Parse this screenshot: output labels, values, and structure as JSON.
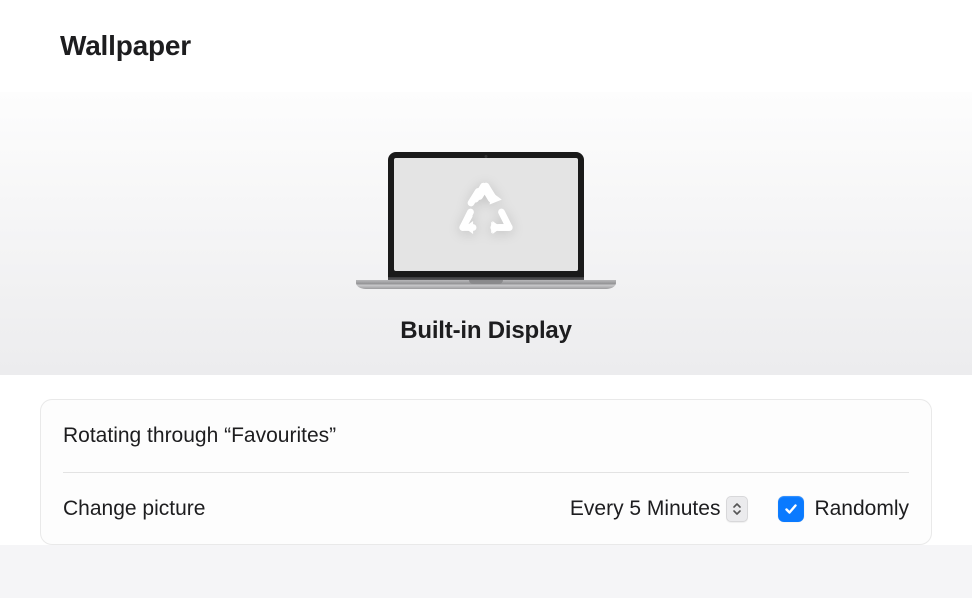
{
  "header": {
    "title": "Wallpaper"
  },
  "preview": {
    "display_label": "Built-in Display",
    "icon": "recycle-icon"
  },
  "settings": {
    "rotating_label": "Rotating through “Favourites”",
    "change_picture_label": "Change picture",
    "change_picture_value": "Every 5 Minutes",
    "randomly_label": "Randomly",
    "randomly_checked": true
  },
  "colors": {
    "accent": "#0a7aff"
  }
}
